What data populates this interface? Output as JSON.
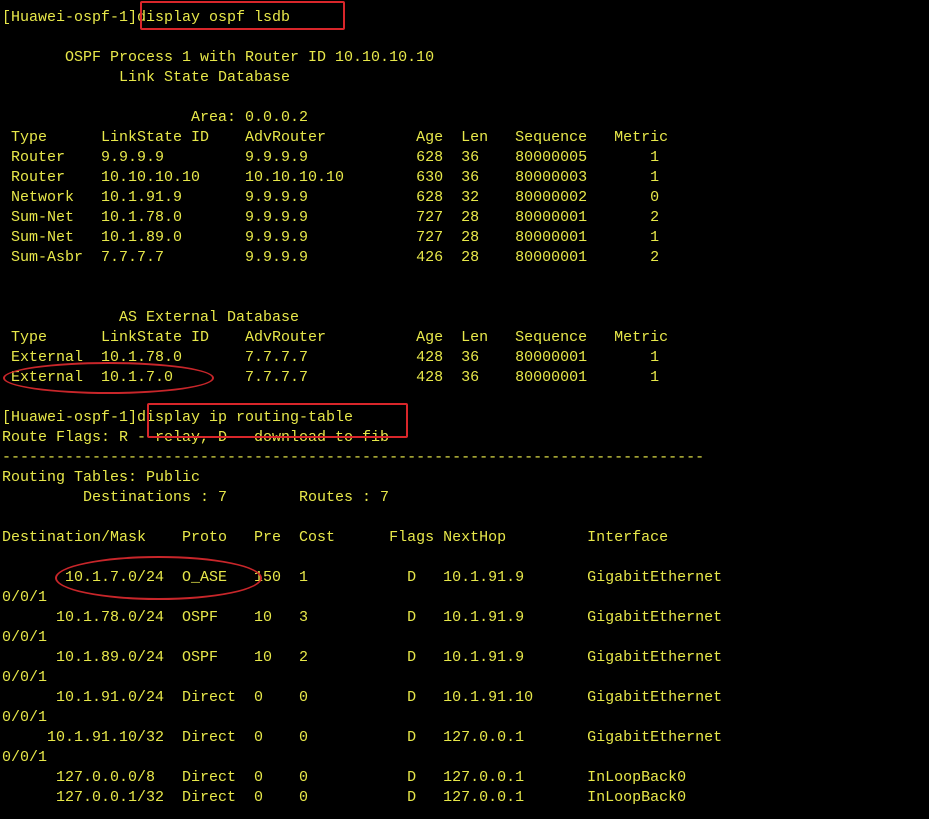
{
  "terminal": {
    "accent_color": "#d8262a",
    "text_color": "#e8e84a",
    "background_color": "#000000",
    "lines": [
      "[Huawei-ospf-1]display ospf lsdb",
      "",
      "       OSPF Process 1 with Router ID 10.10.10.10",
      "             Link State Database",
      "",
      "                     Area: 0.0.0.2",
      " Type      LinkState ID    AdvRouter          Age  Len   Sequence   Metric",
      " Router    9.9.9.9         9.9.9.9            628  36    80000005       1",
      " Router    10.10.10.10     10.10.10.10        630  36    80000003       1",
      " Network   10.1.91.9       9.9.9.9            628  32    80000002       0",
      " Sum-Net   10.1.78.0       9.9.9.9            727  28    80000001       2",
      " Sum-Net   10.1.89.0       9.9.9.9            727  28    80000001       1",
      " Sum-Asbr  7.7.7.7         9.9.9.9            426  28    80000001       2",
      "",
      "",
      "             AS External Database",
      " Type      LinkState ID    AdvRouter          Age  Len   Sequence   Metric",
      " External  10.1.78.0       7.7.7.7            428  36    80000001       1",
      " External  10.1.7.0        7.7.7.7            428  36    80000001       1",
      "",
      "[Huawei-ospf-1]display ip routing-table",
      "Route Flags: R - relay, D - download to fib",
      "------------------------------------------------------------------------------",
      "Routing Tables: Public",
      "         Destinations : 7        Routes : 7",
      "",
      "Destination/Mask    Proto   Pre  Cost      Flags NextHop         Interface",
      "",
      "       10.1.7.0/24  O_ASE   150  1           D   10.1.91.9       GigabitEthernet",
      "0/0/1",
      "      10.1.78.0/24  OSPF    10   3           D   10.1.91.9       GigabitEthernet",
      "0/0/1",
      "      10.1.89.0/24  OSPF    10   2           D   10.1.91.9       GigabitEthernet",
      "0/0/1",
      "      10.1.91.0/24  Direct  0    0           D   10.1.91.10      GigabitEthernet",
      "0/0/1",
      "     10.1.91.10/32  Direct  0    0           D   127.0.0.1       GigabitEthernet",
      "0/0/1",
      "      127.0.0.0/8   Direct  0    0           D   127.0.0.1       InLoopBack0",
      "      127.0.0.1/32  Direct  0    0           D   127.0.0.1       InLoopBack0"
    ]
  }
}
